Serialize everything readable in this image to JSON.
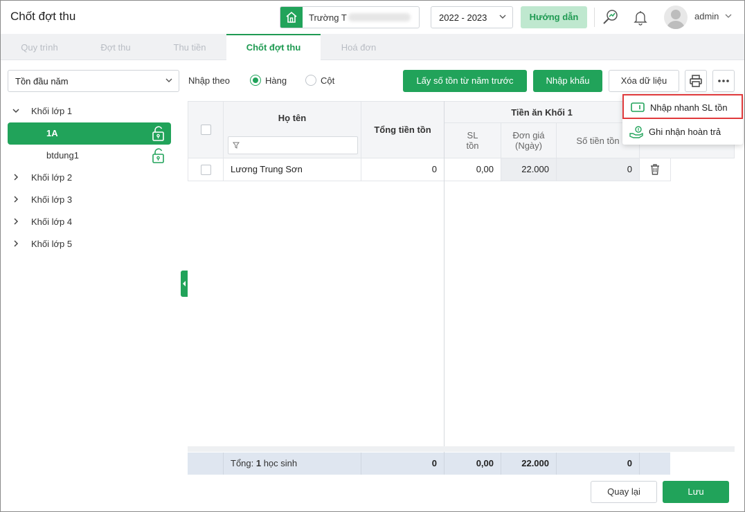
{
  "header": {
    "title": "Chốt đợt thu",
    "school_prefix": "Trường T",
    "year": "2022 - 2023",
    "guide_label": "Hướng dẫn",
    "username": "admin"
  },
  "tabs": [
    {
      "label": "Quy trình",
      "active": false
    },
    {
      "label": "Đợt thu",
      "active": false
    },
    {
      "label": "Thu tiền",
      "active": false
    },
    {
      "label": "Chốt đợt thu",
      "active": true
    },
    {
      "label": "Hoá đơn",
      "active": false
    }
  ],
  "toolbar": {
    "type_select": "Tồn đầu năm",
    "input_by_label": "Nhập theo",
    "radio_row": "Hàng",
    "radio_col": "Cột",
    "btn_prev_year": "Lấy số tồn từ năm trước",
    "btn_import": "Nhập khẩu",
    "btn_clear": "Xóa dữ liệu"
  },
  "tree": {
    "grade1": "Khối lớp 1",
    "class_1a": "1A",
    "class_btdung": "btdung1",
    "grade2": "Khối lớp 2",
    "grade3": "Khối lớp 3",
    "grade4": "Khối lớp 4",
    "grade5": "Khối lớp 5"
  },
  "grid": {
    "col_name": "Họ tên",
    "col_total": "Tổng tiền tồn",
    "group_header": "Tiền ăn Khối 1",
    "col_qty": "SL tồn",
    "col_qty_l1": "SL",
    "col_qty_l2": "tồn",
    "col_price_l1": "Đơn giá",
    "col_price_l2": "(Ngày)",
    "col_amount": "Số tiền tồn",
    "rows": [
      {
        "name": "Lương Trung Sơn",
        "total": "0",
        "qty": "0,00",
        "price": "22.000",
        "amount": "0"
      }
    ],
    "footer": {
      "label_prefix": "Tổng: ",
      "count": "1",
      "label_suffix": " học sinh",
      "total": "0",
      "qty": "0,00",
      "price": "22.000",
      "amount": "0"
    }
  },
  "menu": {
    "quick_qty": "Nhập nhanh SL tồn",
    "refund": "Ghi nhận hoàn trả"
  },
  "footer_buttons": {
    "back": "Quay lại",
    "save": "Lưu"
  },
  "colors": {
    "accent": "#21a35a",
    "highlight": "#e0393b"
  }
}
